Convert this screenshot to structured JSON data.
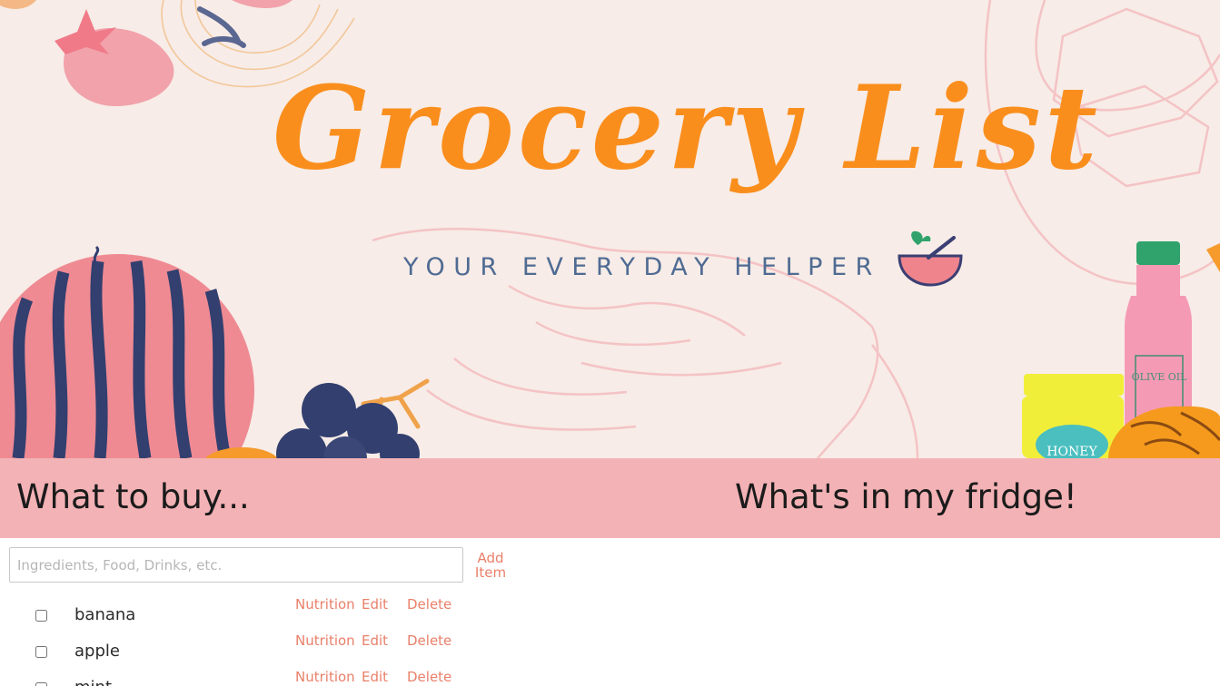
{
  "banner": {
    "title": "Grocery List",
    "tagline": "YOUR EVERYDAY HELPER",
    "jar_label_oil": "OLIVE OIL",
    "jar_label_honey": "HONEY"
  },
  "sections": {
    "buy_heading": "What to buy...",
    "fridge_heading": "What's in my fridge!"
  },
  "add_form": {
    "placeholder": "Ingredients, Food, Drinks, etc.",
    "value": "",
    "button_label": "Add Item"
  },
  "actions": {
    "nutrition": "Nutrition",
    "edit": "Edit",
    "delete": "Delete"
  },
  "items": [
    {
      "name": "banana",
      "checked": false
    },
    {
      "name": "apple",
      "checked": false
    },
    {
      "name": "mint",
      "checked": false
    }
  ],
  "colors": {
    "accent_orange": "#fa8e1d",
    "link_coral": "#e9806a",
    "header_pink": "#f3b2b5",
    "banner_bg": "#f7ece7",
    "navy": "#38426f"
  }
}
